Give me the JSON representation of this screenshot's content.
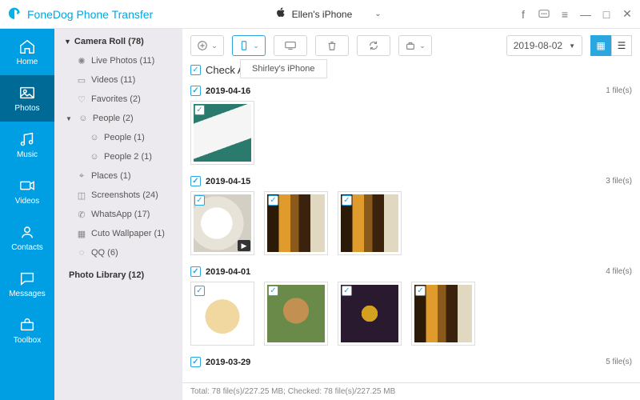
{
  "app": {
    "title": "FoneDog Phone Transfer"
  },
  "device": {
    "name": "Ellen's iPhone",
    "icon": "apple-icon"
  },
  "nav": {
    "items": [
      {
        "label": "Home"
      },
      {
        "label": "Photos"
      },
      {
        "label": "Music"
      },
      {
        "label": "Videos"
      },
      {
        "label": "Contacts"
      },
      {
        "label": "Messages"
      },
      {
        "label": "Toolbox"
      }
    ],
    "active_index": 1
  },
  "sidebar": {
    "group_label": "Camera Roll (78)",
    "items": [
      {
        "label": "Live Photos (11)",
        "icon": "sparkle-icon"
      },
      {
        "label": "Videos (11)",
        "icon": "video-icon"
      },
      {
        "label": "Favorites (2)",
        "icon": "heart-icon"
      }
    ],
    "people_group": {
      "label": "People (2)",
      "icon": "people-icon"
    },
    "people_children": [
      {
        "label": "People (1)",
        "icon": "person-icon"
      },
      {
        "label": "People 2 (1)",
        "icon": "person-icon"
      }
    ],
    "items2": [
      {
        "label": "Places (1)",
        "icon": "pin-icon"
      },
      {
        "label": "Screenshots (24)",
        "icon": "screenshot-icon"
      },
      {
        "label": "WhatsApp (17)",
        "icon": "whatsapp-icon"
      },
      {
        "label": "Cuto Wallpaper (1)",
        "icon": "image-icon"
      },
      {
        "label": "QQ (6)",
        "icon": "qq-icon"
      }
    ],
    "second_group_label": "Photo Library (12)"
  },
  "toolbar": {
    "tooltip": "Shirley's iPhone",
    "date_filter": "2019-08-02"
  },
  "checkall_label": "Check All(78)",
  "groups": [
    {
      "date": "2019-04-16",
      "count_label": "1 file(s)",
      "thumbs": [
        {
          "cls": "ph-phone"
        }
      ]
    },
    {
      "date": "2019-04-15",
      "count_label": "3 file(s)",
      "thumbs": [
        {
          "cls": "ph-cup",
          "video": true
        },
        {
          "cls": "ph-bar"
        },
        {
          "cls": "ph-bar"
        }
      ]
    },
    {
      "date": "2019-04-01",
      "count_label": "4 file(s)",
      "thumbs": [
        {
          "cls": "ph-dog1"
        },
        {
          "cls": "ph-dog2"
        },
        {
          "cls": "ph-dark"
        },
        {
          "cls": "ph-bar"
        }
      ]
    },
    {
      "date": "2019-03-29",
      "count_label": "5 file(s)",
      "thumbs": []
    }
  ],
  "footer": {
    "text": "Total: 78 file(s)/227.25 MB; Checked: 78 file(s)/227.25 MB"
  }
}
